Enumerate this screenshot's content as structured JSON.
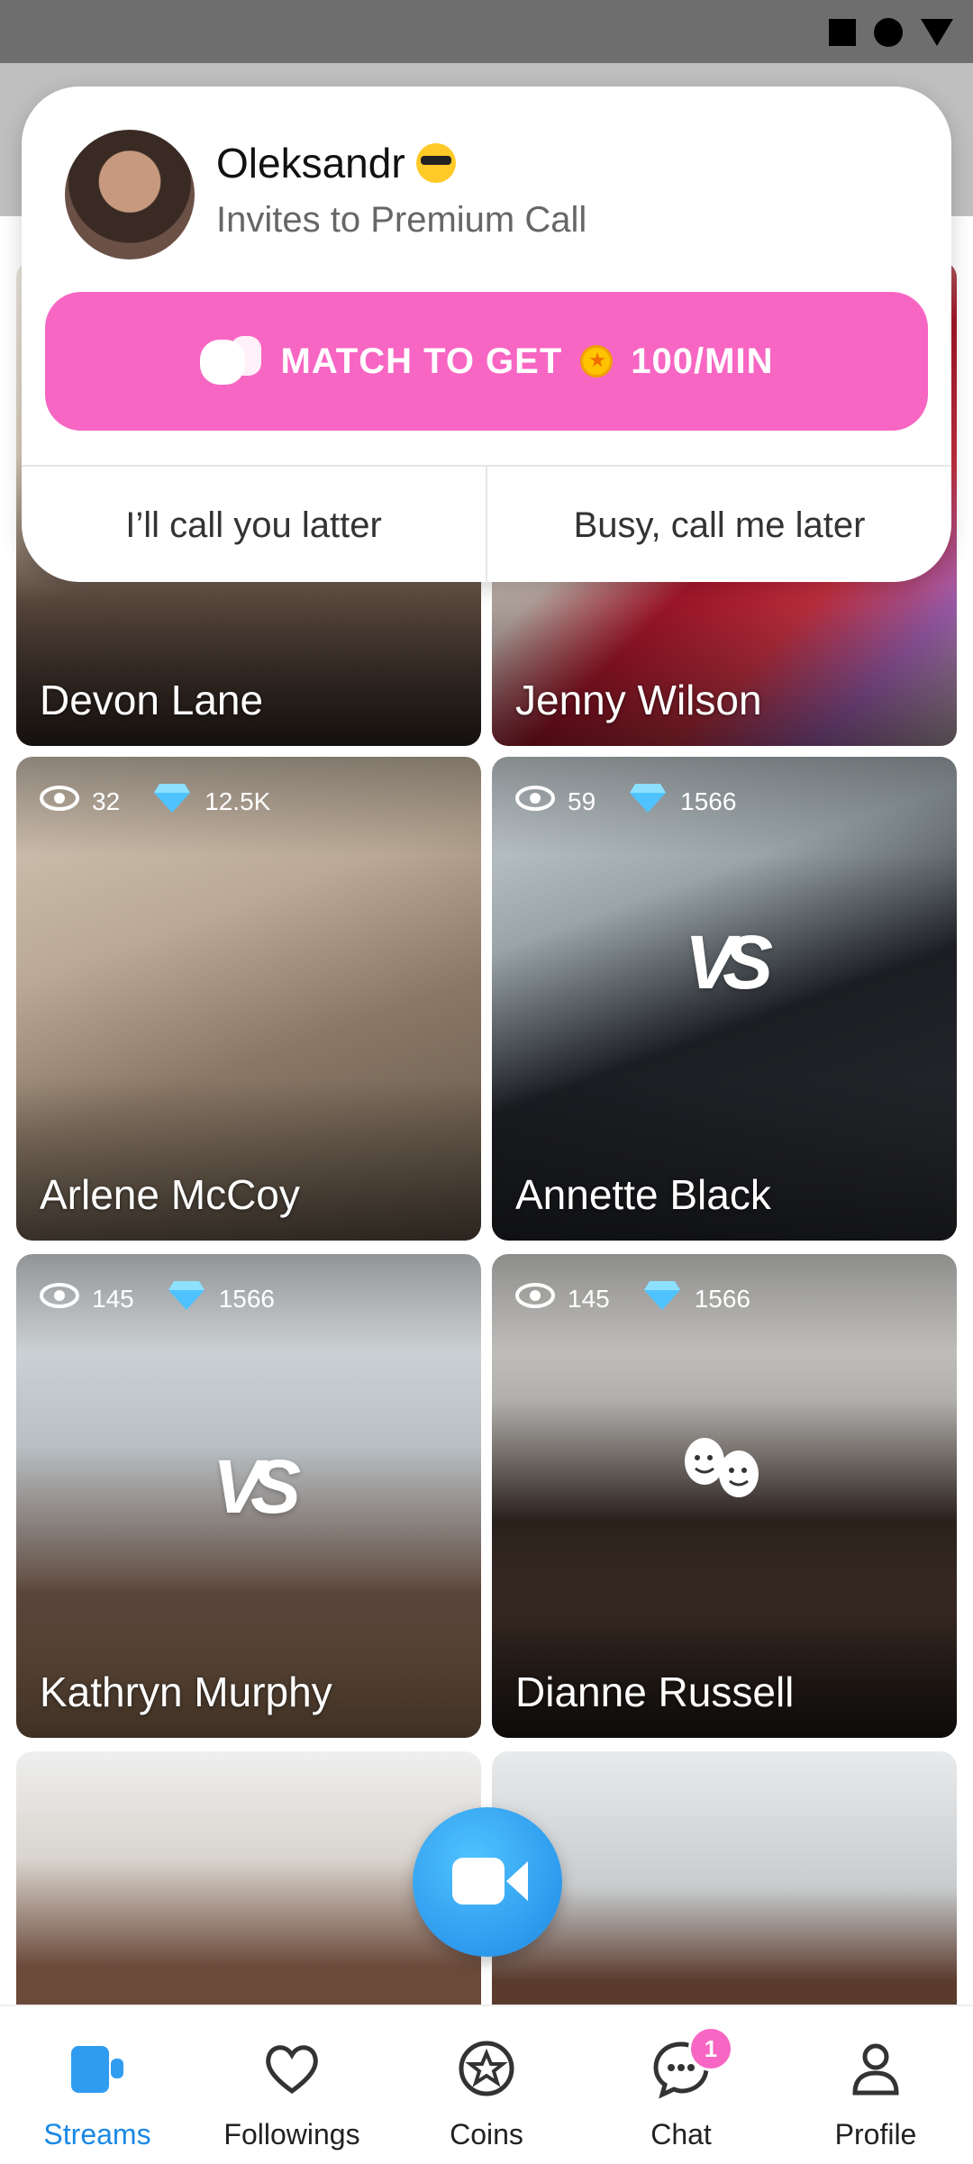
{
  "popup": {
    "caller_name": "Oleksandr",
    "subtitle": "Invites to Premium Call",
    "match_button": {
      "label_start": "MATCH TO GET",
      "label_end": "100/MIN"
    },
    "decline_left": "I’ll call you latter",
    "decline_right": "Busy, call me later"
  },
  "streams": [
    {
      "name": "Devon Lane"
    },
    {
      "name": "Jenny Wilson"
    },
    {
      "name": "Arlene McCoy",
      "viewers": "32",
      "gems": "12.5K"
    },
    {
      "name": "Annette Black",
      "viewers": "59",
      "gems": "1566",
      "badge": "VS"
    },
    {
      "name": "Kathryn Murphy",
      "viewers": "145",
      "gems": "1566",
      "badge": "VS"
    },
    {
      "name": "Dianne Russell",
      "viewers": "145",
      "gems": "1566"
    }
  ],
  "nav": {
    "items": [
      {
        "label": "Streams",
        "icon": "streams-icon"
      },
      {
        "label": "Followings",
        "icon": "heart-icon"
      },
      {
        "label": "Coins",
        "icon": "coin-star-icon"
      },
      {
        "label": "Chat",
        "icon": "chat-icon",
        "badge": "1"
      },
      {
        "label": "Profile",
        "icon": "profile-icon"
      }
    ]
  },
  "colors": {
    "accent_pink": "#f766c3",
    "accent_blue": "#1a88e5"
  }
}
